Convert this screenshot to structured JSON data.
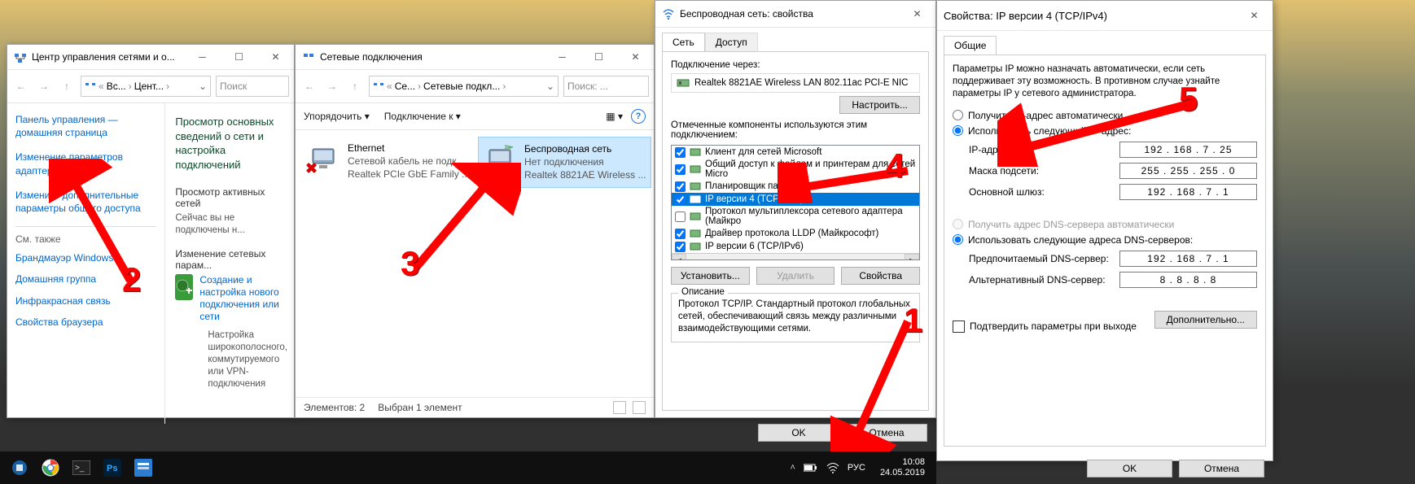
{
  "w1": {
    "title": "Центр управления сетями и о...",
    "breadcrumb": {
      "a": "Вс...",
      "b": "Цент..."
    },
    "search_ph": "Поиск",
    "side": {
      "home1": "Панель управления —",
      "home2": "домашняя страница",
      "link1a": "Изменение параметров",
      "link1b": "адаптера",
      "link2a": "Изменить дополнительные",
      "link2b": "параметры общего доступа",
      "see": "См. также",
      "s1": "Брандмауэр Windows",
      "s2": "Домашняя группа",
      "s3": "Инфракрасная связь",
      "s4": "Свойства браузера"
    },
    "main": {
      "h": "Просмотр основных сведений о сети и настройка подключений",
      "sub1": "Просмотр активных сетей",
      "desc1": "Сейчас вы не подключены н...",
      "sub2": "Изменение сетевых парам...",
      "task1": "Создание и настройка нового подключения или сети",
      "task2": "Настройка широкополосного, коммутируемого или VPN-подключения"
    }
  },
  "w2": {
    "title": "Сетевые подключения",
    "breadcrumb": {
      "a": "Се...",
      "b": "Сетевые подкл..."
    },
    "search_ph": "Поиск: ...",
    "tb1": "Упорядочить",
    "tb2": "Подключение к",
    "eth": {
      "l1": "Ethernet",
      "l2": "Сетевой кабель не подк...",
      "l3": "Realtek PCIe GbE Family ..."
    },
    "wifi": {
      "l1": "Беспроводная сеть",
      "l2": "Нет подключения",
      "l3": "Realtek 8821AE Wireless ..."
    },
    "st1": "Элементов: 2",
    "st2": "Выбран 1 элемент"
  },
  "w3": {
    "title": "Беспроводная сеть: свойства",
    "tab1": "Сеть",
    "tab2": "Доступ",
    "connvia": "Подключение через:",
    "adapter": "Realtek 8821AE Wireless LAN 802.11ac PCI-E NIC",
    "configure": "Настроить...",
    "complbl": "Отмеченные компоненты используются этим подключением:",
    "comps": [
      {
        "chk": true,
        "label": "Клиент для сетей Microsoft"
      },
      {
        "chk": true,
        "label": "Общий доступ к файлам и принтерам для сетей Micro"
      },
      {
        "chk": true,
        "label": "Планировщик пакетов QoS"
      },
      {
        "chk": true,
        "label": "IP версии 4 (TCP/IPv4)",
        "sel": true
      },
      {
        "chk": false,
        "label": "Протокол мультиплексора сетевого адаптера (Майкро"
      },
      {
        "chk": true,
        "label": "Драйвер протокола LLDP (Майкрософт)"
      },
      {
        "chk": true,
        "label": "IP версии 6 (TCP/IPv6)"
      }
    ],
    "install": "Установить...",
    "remove": "Удалить",
    "props": "Свойства",
    "descgrp": "Описание",
    "desc": "Протокол TCP/IP. Стандартный протокол глобальных сетей, обеспечивающий связь между различными взаимодействующими сетями.",
    "ok": "OK",
    "cancel": "Отмена"
  },
  "w4": {
    "title": "Свойства: IP версии 4 (TCP/IPv4)",
    "tab": "Общие",
    "intro": "Параметры IP можно назначать автоматически, если сеть поддерживает эту возможность. В противном случае узнайте параметры IP у сетевого администратора.",
    "r1": "Получить IP-адрес автоматически",
    "r2": "Использовать следующий IP-адрес:",
    "ip_l": "IP-адрес:",
    "ip_v": "192 . 168 .  7  . 25",
    "mask_l": "Маска подсети:",
    "mask_v": "255 . 255 . 255 .  0",
    "gw_l": "Основной шлюз:",
    "gw_v": "192 . 168 .  7  .  1",
    "r3": "Получить адрес DNS-сервера автоматически",
    "r4": "Использовать следующие адреса DNS-серверов:",
    "dns1_l": "Предпочитаемый DNS-сервер:",
    "dns1_v": "192 . 168 .  7  .  1",
    "dns2_l": "Альтернативный DNS-сервер:",
    "dns2_v": " 8  .  8  .  8  .  8",
    "verify": "Подтвердить параметры при выходе",
    "adv": "Дополнительно...",
    "ok": "OK",
    "cancel": "Отмена"
  },
  "tb": {
    "lang": "РУС",
    "time": "10:08",
    "date": "24.05.2019"
  },
  "nums": {
    "n1": "1",
    "n2": "2",
    "n3": "3",
    "n4": "4",
    "n5": "5"
  }
}
